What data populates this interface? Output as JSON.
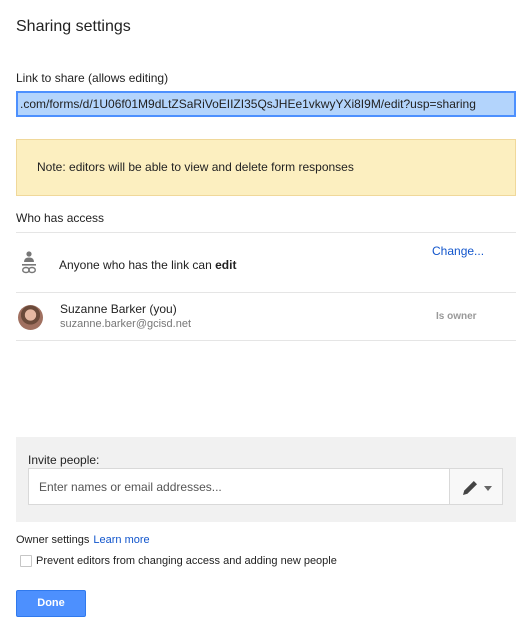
{
  "dialog": {
    "title": "Sharing settings"
  },
  "link_share": {
    "label": "Link to share (allows editing)",
    "url": ".com/forms/d/1U06f01M9dLtZSaRiVoEIIZI35QsJHEe1vkwyYXi8I9M/edit?usp=sharing"
  },
  "note": {
    "text": "Note: editors will be able to view and delete form responses"
  },
  "access": {
    "label": "Who has access",
    "link_entry": {
      "prefix": "Anyone who has the link can ",
      "permission": "edit",
      "icon": "link-person-icon"
    },
    "change_link": "Change...",
    "owner": {
      "name": "Suzanne Barker (you)",
      "email": "suzanne.barker@gcisd.net",
      "role": "Is owner"
    }
  },
  "invite": {
    "label": "Invite people:",
    "placeholder": "Enter names or email addresses...",
    "value": "",
    "permission_icon": "pencil-icon"
  },
  "owner_settings": {
    "label": "Owner settings",
    "learn_more": "Learn more",
    "prevent_label": "Prevent editors from changing access and adding new people",
    "prevent_checked": false
  },
  "done_label": "Done",
  "colors": {
    "accent": "#4d90fe",
    "link": "#1155cc",
    "note_bg": "#fcefc0",
    "panel_bg": "#f1f1f1"
  }
}
